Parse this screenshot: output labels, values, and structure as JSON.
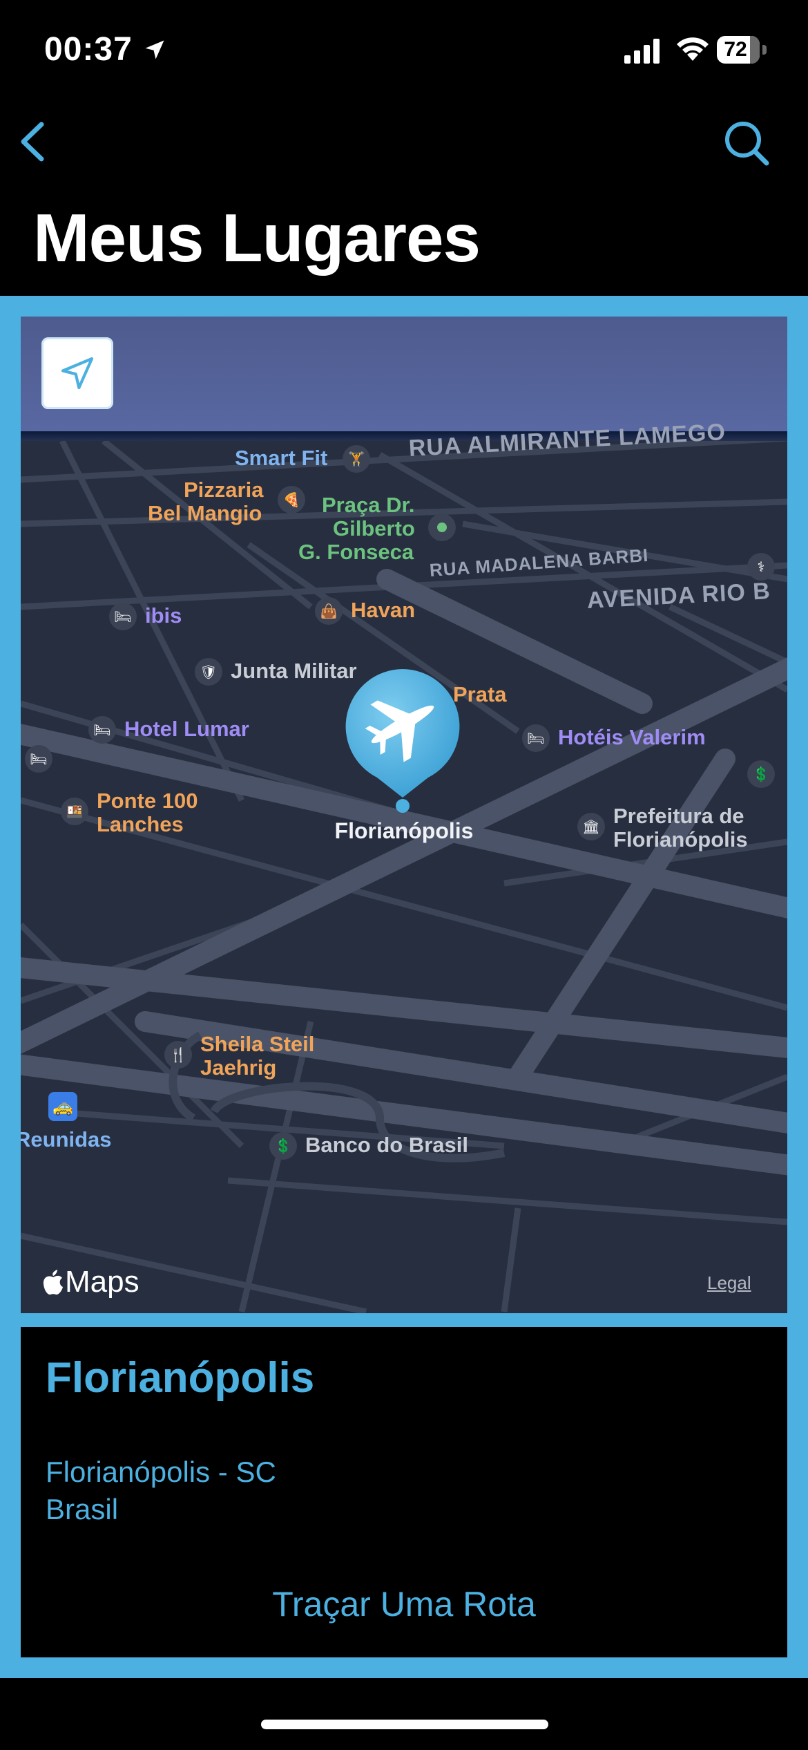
{
  "status_bar": {
    "time": "00:37",
    "battery": "72"
  },
  "nav": {
    "title": "Meus Lugares"
  },
  "map": {
    "streets": [
      "RUA ALMIRANTE LAMEGO",
      "RUA MADALENA BARBI",
      "AVENIDA RIO B"
    ],
    "pois": {
      "smart_fit": "Smart Fit",
      "pizzaria_line1": "Pizzaria",
      "pizzaria_line2": "Bel Mangio",
      "praca_line1": "Praça Dr.",
      "praca_line2": "Gilberto",
      "praca_line3": "G. Fonseca",
      "ibis": "ibis",
      "havan": "Havan",
      "junta_militar": "Junta Militar",
      "prata": "Prata",
      "hotel_lumar": "Hotel Lumar",
      "hoteis_valerim": "Hotéis Valerim",
      "ponte_line1": "Ponte 100",
      "ponte_line2": "Lanches",
      "prefeitura_line1": "Prefeitura de",
      "prefeitura_line2": "Florianópolis",
      "sheila_line1": "Sheila Steil",
      "sheila_line2": "Jaehrig",
      "reunidas": "Reunidas",
      "banco": "Banco do Brasil"
    },
    "marker_label": "Florianópolis",
    "maps_brand": "Maps",
    "legal": "Legal"
  },
  "place": {
    "title": "Florianópolis",
    "address_line1": "Florianópolis - SC",
    "address_line2": "Brasil",
    "route_button": "Traçar Uma Rota"
  },
  "colors": {
    "accent": "#4cb0e0",
    "map_bg": "#272e3f"
  }
}
